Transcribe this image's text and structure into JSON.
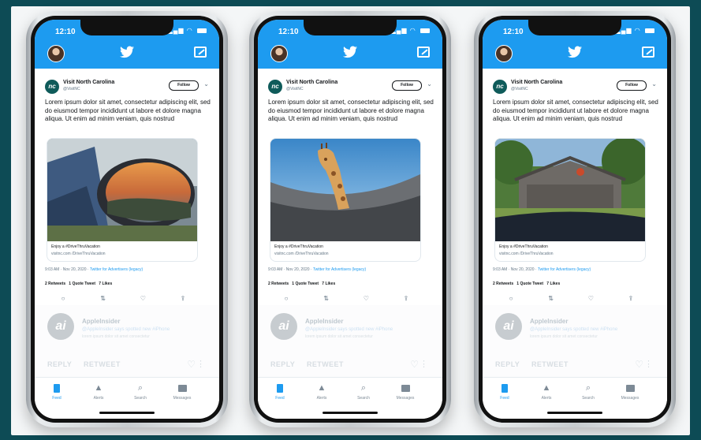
{
  "colors": {
    "twitter_blue": "#1d9bf0",
    "background": "#0d4b55"
  },
  "phones": [
    {
      "status_time": "12:10",
      "tweet": {
        "account_name": "Visit North Carolina",
        "handle": "@VisitNC",
        "follow_label": "Follow",
        "text": "Lorem ipsum dolor sit amet, consectetur adipiscing elit, sed do eiusmod tempor incididunt ut labore et dolore magna aliqua. Ut enim ad minim veniam, quis nostrud",
        "image": "car-side-mirror-mountains",
        "card_title": "Enjoy a #DriveThruVacation",
        "card_url": "visitnc.com /DriveThruVacation",
        "meta": "9:03 AM · Nov 20, 2020 ·",
        "source": "Twitter for Advertisers (legacy)",
        "retweets": "2 Retweets",
        "quote_tweet": "1 Quote Tweet",
        "likes": "7 Likes"
      },
      "faded": {
        "name": "AppleInsider",
        "handle": "@appleinsider",
        "line1": "@AppleInsider says spotted new #iPhone",
        "line2": "lorem ipsum dolor sit amet consectetur",
        "reply": "REPLY",
        "retweet": "RETWEET"
      }
    },
    {
      "status_time": "12:10",
      "tweet": {
        "account_name": "Visit North Carolina",
        "handle": "@VisitNC",
        "follow_label": "Follow",
        "text": "Lorem ipsum dolor sit amet, consectetur adipiscing elit, sed do eiusmod tempor incididunt ut labore et dolore magna aliqua. Ut enim ad minim veniam, quis nostrud",
        "image": "giraffe-through-sunroof",
        "card_title": "Enjoy a #DriveThruVacation",
        "card_url": "visitnc.com /DriveThruVacation",
        "meta": "9:03 AM · Nov 20, 2020 ·",
        "source": "Twitter for Advertisers (legacy)",
        "retweets": "2 Retweets",
        "quote_tweet": "1 Quote Tweet",
        "likes": "7 Likes"
      },
      "faded": {
        "name": "AppleInsider",
        "handle": "@appleinsider",
        "line1": "@AppleInsider says spotted new #iPhone",
        "line2": "lorem ipsum dolor sit amet consectetur",
        "reply": "REPLY",
        "retweet": "RETWEET"
      }
    },
    {
      "status_time": "12:10",
      "tweet": {
        "account_name": "Visit North Carolina",
        "handle": "@VisitNC",
        "follow_label": "Follow",
        "text": "Lorem ipsum dolor sit amet, consectetur adipiscing elit, sed do eiusmod tempor incididunt ut labore et dolore magna aliqua. Ut enim ad minim veniam, quis nostrud",
        "image": "barn-through-windshield",
        "card_title": "Enjoy a #DriveThruVacation",
        "card_url": "visitnc.com /DriveThruVacation",
        "meta": "9:03 AM · Nov 20, 2020 ·",
        "source": "Twitter for Advertisers (legacy)",
        "retweets": "2 Retweets",
        "quote_tweet": "1 Quote Tweet",
        "likes": "7 Likes"
      },
      "faded": {
        "name": "AppleInsider",
        "handle": "@appleinsider",
        "line1": "@AppleInsider says spotted new #iPhone",
        "line2": "lorem ipsum dolor sit amet consectetur",
        "reply": "REPLY",
        "retweet": "RETWEET"
      }
    }
  ],
  "tabbar": {
    "feed": "Feed",
    "alerts": "Alerts",
    "search": "Search",
    "messages": "Messages"
  }
}
